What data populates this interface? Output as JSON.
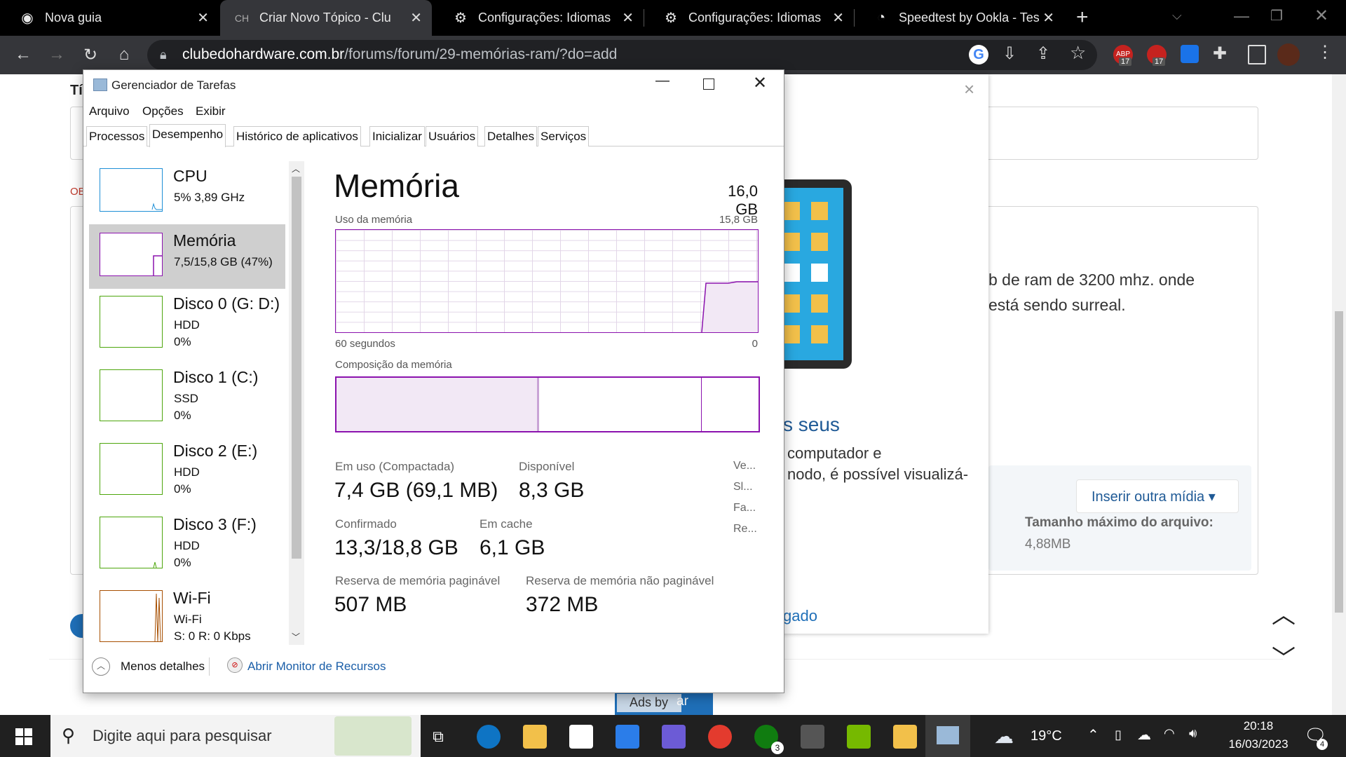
{
  "browser": {
    "tabs": [
      {
        "title": "Nova guia",
        "icon": "chrome-icon",
        "active": false
      },
      {
        "title": "Criar Novo Tópico - Clu",
        "icon": "clubedohardware-icon",
        "active": true
      },
      {
        "title": "Configurações: Idiomas",
        "icon": "gear-icon",
        "active": false
      },
      {
        "title": "Configurações: Idiomas",
        "icon": "gear-icon",
        "active": false
      },
      {
        "title": "Speedtest by Ookla - Test",
        "icon": "speedtest-icon",
        "active": false
      }
    ],
    "url_domain": "clubedohardware.com.br",
    "url_path": "/forums/forum/29-memórias-ram/?do=add",
    "ext_badge_1": "17",
    "ext_badge_2": "17",
    "ext_label_abp": "ABP"
  },
  "page": {
    "heading_partial": "Tí",
    "label_partial": "OB",
    "text_line1": "b de ram de 3200 mhz. onde",
    "text_line2": "está sendo surreal.",
    "modal_heading_partial": "s seus",
    "modal_text_line1": "computador e",
    "modal_text_line2": "nodo, é possível visualizá-",
    "insert_media_label": "Inserir outra mídia ▾",
    "max_size_label": "Tamanho máximo do arquivo:",
    "max_size_value": "4,88MB",
    "link_partial": "gado",
    "ads_label": "Ads by",
    "ads_button_partial": "ar"
  },
  "taskmanager": {
    "title": "Gerenciador de Tarefas",
    "menu": [
      "Arquivo",
      "Opções",
      "Exibir"
    ],
    "tabs": [
      "Processos",
      "Desempenho",
      "Histórico de aplicativos",
      "Inicializar",
      "Usuários",
      "Detalhes",
      "Serviços"
    ],
    "active_tab": "Desempenho",
    "sidebar": [
      {
        "name": "CPU",
        "line1": "5% 3,89 GHz",
        "line2": "",
        "color": "#1e8fd6"
      },
      {
        "name": "Memória",
        "line1": "7,5/15,8 GB (47%)",
        "line2": "",
        "color": "#8b12ae"
      },
      {
        "name": "Disco 0 (G: D:)",
        "line1": "HDD",
        "line2": "0%",
        "color": "#4da60c"
      },
      {
        "name": "Disco 1 (C:)",
        "line1": "SSD",
        "line2": "0%",
        "color": "#4da60c"
      },
      {
        "name": "Disco 2 (E:)",
        "line1": "HDD",
        "line2": "0%",
        "color": "#4da60c"
      },
      {
        "name": "Disco 3 (F:)",
        "line1": "HDD",
        "line2": "0%",
        "color": "#4da60c"
      },
      {
        "name": "Wi-Fi",
        "line1": "Wi-Fi",
        "line2": "S: 0 R: 0 Kbps",
        "color": "#a74f01"
      }
    ],
    "main": {
      "heading": "Memória",
      "total": "16,0 GB",
      "usage_label": "Uso da memória",
      "usage_max": "15,8 GB",
      "time_left": "60 segundos",
      "time_right": "0",
      "composition_label": "Composição da memória",
      "stats": [
        {
          "label": "Em uso (Compactada)",
          "value": "7,4 GB (69,1 MB)"
        },
        {
          "label": "Disponível",
          "value": "8,3 GB"
        },
        {
          "label": "Confirmado",
          "value": "13,3/18,8 GB"
        },
        {
          "label": "Em cache",
          "value": "6,1 GB"
        },
        {
          "label": "Reserva de memória paginável",
          "value": "507 MB"
        },
        {
          "label": "Reserva de memória não paginável",
          "value": "372 MB"
        }
      ],
      "right_labels": [
        "Ve...",
        "Sl...",
        "Fa...",
        "Re..."
      ]
    },
    "footer": {
      "less_details": "Menos detalhes",
      "resource_monitor": "Abrir Monitor de Recursos"
    }
  },
  "taskbar": {
    "search_placeholder": "Digite aqui para pesquisar",
    "weather": "19°C",
    "time": "20:18",
    "date": "16/03/2023",
    "notification_count": "4",
    "xbox_badge": "3"
  }
}
